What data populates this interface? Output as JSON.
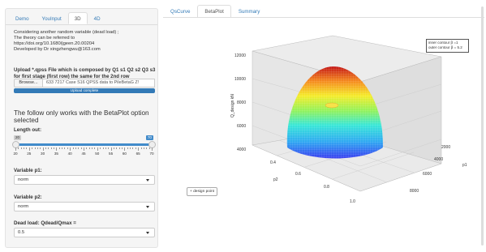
{
  "sidebar": {
    "tabs": [
      {
        "label": "Demo"
      },
      {
        "label": "YouInput"
      },
      {
        "label": "3D"
      },
      {
        "label": "4D"
      }
    ],
    "info_lines": [
      "Considering another random variable (dead load) ;",
      "The theory can be referred to",
      "https://doi.org/10.1680/jgeen.20.00204",
      "Developed by Dr xingzhengwu@163.com"
    ],
    "upload_label_line1": "Upload *.qpss File which is composed by Q1 s1 Q2 s2 Q3 s3",
    "upload_label_line2": "for first stage (first row) the same for the 2nd row",
    "browse_label": "Browse...",
    "file_name": "633 7217 Case S16 QPSS data to PileBetaG Z!",
    "upload_status": "Upload complete",
    "upload_progress": 1.0,
    "section_title_line1": "The follow only works with the BetaPlot option",
    "section_title_line2": "selected",
    "length_label": "Length out:",
    "slider": {
      "min": 20,
      "max": 70,
      "value_low": 20,
      "value_high": 70,
      "ticks": [
        "20",
        "25",
        "30",
        "35",
        "40",
        "45",
        "50",
        "55",
        "60",
        "65",
        "70"
      ]
    },
    "var_p1_label": "Variable p1:",
    "var_p1_value": "norm",
    "var_p2_label": "Variable p2:",
    "var_p2_value": "norm",
    "dead_load_label": "Dead load: Qdead/Qmax =",
    "dead_load_value": "0.5"
  },
  "main": {
    "tabs": [
      {
        "label": "QsCurve"
      },
      {
        "label": "BetaPlot"
      },
      {
        "label": "Summary"
      }
    ],
    "active_tab": "BetaPlot",
    "legend_line1": "inner contour β =1",
    "legend_line2": "outer contour β = 5.2",
    "design_button": "+ design point",
    "z_axis_label": "Q_design kN",
    "z_ticks": [
      "12000",
      "10000",
      "8000",
      "6000",
      "4000"
    ],
    "x_axis_label": "p1",
    "x_ticks": [
      "2000",
      "4000",
      "6000",
      "8000"
    ],
    "y_axis_label": "p2",
    "y_ticks": [
      "0.4",
      "0.6",
      "0.8",
      "1.0"
    ]
  }
}
